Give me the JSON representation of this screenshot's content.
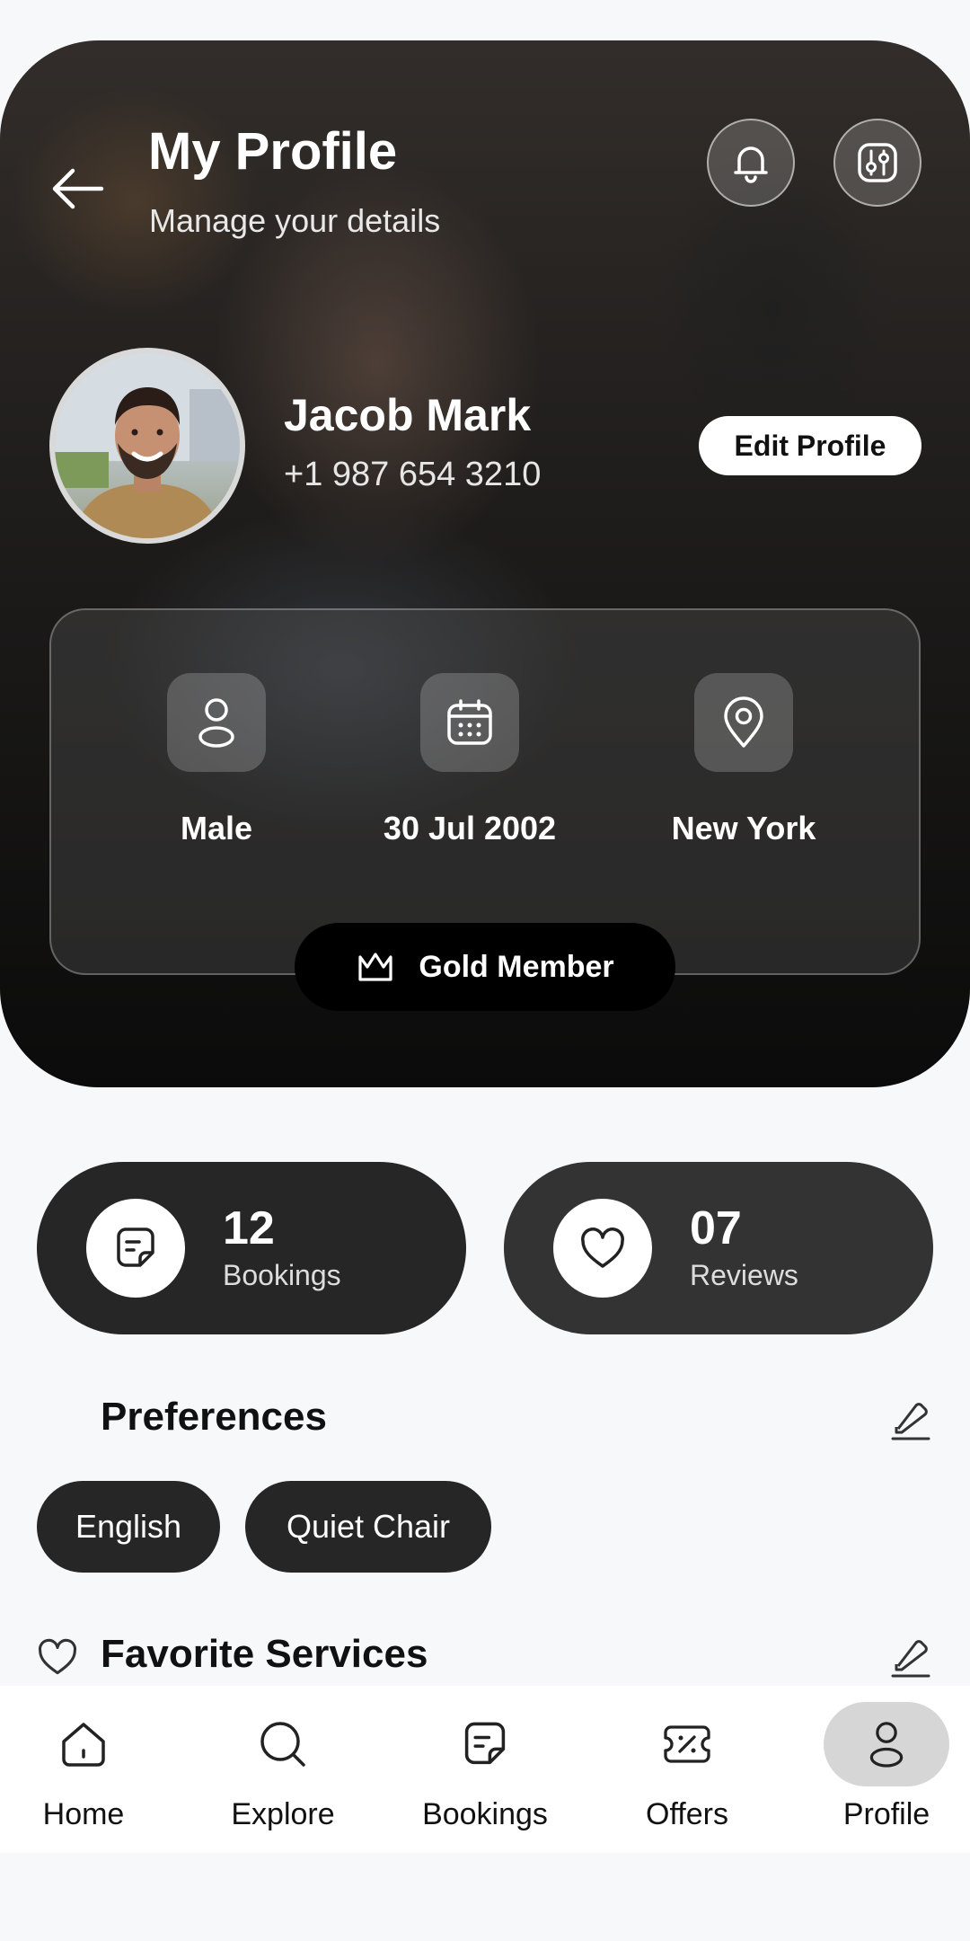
{
  "header": {
    "title": "My Profile",
    "subtitle": "Manage your details"
  },
  "user": {
    "name": "Jacob Mark",
    "phone": "+1 987 654 3210",
    "edit_label": "Edit Profile"
  },
  "details": {
    "gender": "Male",
    "dob": "30 Jul 2002",
    "location": "New York"
  },
  "membership": {
    "label": "Gold Member"
  },
  "stats": [
    {
      "value": "12",
      "label": "Bookings",
      "icon": "document-icon"
    },
    {
      "value": "07",
      "label": "Reviews",
      "icon": "heart-icon"
    }
  ],
  "preferences": {
    "title": "Preferences",
    "chips": [
      "English",
      "Quiet Chair"
    ]
  },
  "favorites": {
    "title": "Favorite Services"
  },
  "nav": {
    "items": [
      {
        "label": "Home",
        "icon": "home-icon"
      },
      {
        "label": "Explore",
        "icon": "search-icon"
      },
      {
        "label": "Bookings",
        "icon": "document-icon"
      },
      {
        "label": "Offers",
        "icon": "ticket-icon"
      },
      {
        "label": "Profile",
        "icon": "user-icon",
        "active": true
      }
    ]
  },
  "colors": {
    "dark_card": "#262626",
    "active_nav": "#d6d6d6",
    "background": "#f7f8fa"
  }
}
